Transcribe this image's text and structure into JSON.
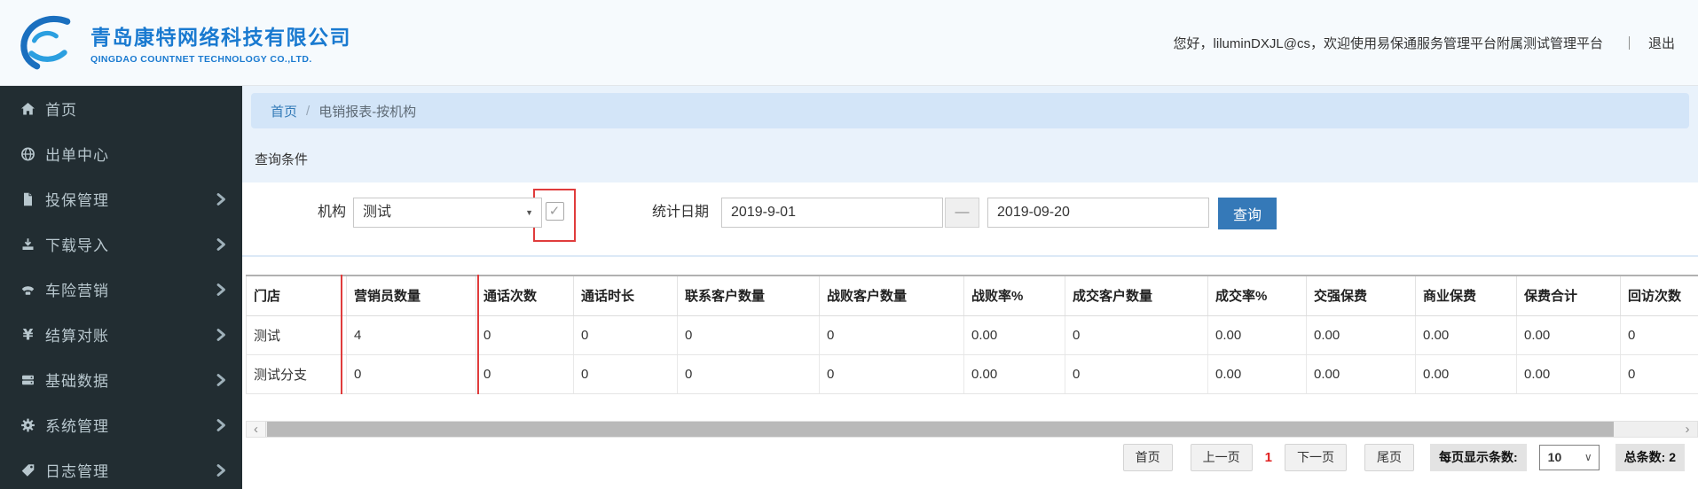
{
  "header": {
    "company_name_cn": "青岛康特网络科技有限公司",
    "company_name_en": "QINGDAO COUNTNET TECHNOLOGY CO.,LTD.",
    "greeting": "您好，liluminDXJL@cs，欢迎使用易保通服务管理平台附属测试管理平台",
    "divider": "｜",
    "logout_label": "退出"
  },
  "sidebar": {
    "items": [
      {
        "id": "home",
        "label": "首页",
        "icon": "home-icon",
        "has_submenu": false
      },
      {
        "id": "order-center",
        "label": "出单中心",
        "icon": "globe-icon",
        "has_submenu": false
      },
      {
        "id": "policy-mgmt",
        "label": "投保管理",
        "icon": "document-icon",
        "has_submenu": true
      },
      {
        "id": "download-import",
        "label": "下载导入",
        "icon": "download-icon",
        "has_submenu": true
      },
      {
        "id": "car-marketing",
        "label": "车险营销",
        "icon": "phone-icon",
        "has_submenu": true
      },
      {
        "id": "settlement",
        "label": "结算对账",
        "icon": "yen-icon",
        "has_submenu": true
      },
      {
        "id": "base-data",
        "label": "基础数据",
        "icon": "drive-icon",
        "has_submenu": true
      },
      {
        "id": "system-mgmt",
        "label": "系统管理",
        "icon": "gear-icon",
        "has_submenu": true
      },
      {
        "id": "log-mgmt",
        "label": "日志管理",
        "icon": "tag-icon",
        "has_submenu": true
      }
    ]
  },
  "breadcrumb": {
    "home": "首页",
    "separator": "/",
    "current": "电销报表-按机构"
  },
  "query": {
    "section_title": "查询条件",
    "org_label": "机构",
    "org_value": "测试",
    "checkbox_checked": true,
    "date_label": "统计日期",
    "date_from": "2019-9-01",
    "date_separator": "—",
    "date_to": "2019-09-20",
    "search_label": "查询"
  },
  "table": {
    "columns": [
      "门店",
      "营销员数量",
      "通话次数",
      "通话时长",
      "联系客户数量",
      "战败客户数量",
      "战败率%",
      "成交客户数量",
      "成交率%",
      "交强保费",
      "商业保费",
      "保费合计",
      "回访次数"
    ],
    "rows": [
      [
        "测试",
        "4",
        "0",
        "0",
        "0",
        "0",
        "0.00",
        "0",
        "0.00",
        "0.00",
        "0.00",
        "0.00",
        "0"
      ],
      [
        "测试分支",
        "0",
        "0",
        "0",
        "0",
        "0",
        "0.00",
        "0",
        "0.00",
        "0.00",
        "0.00",
        "0.00",
        "0"
      ]
    ]
  },
  "pagination": {
    "first": "首页",
    "prev": "上一页",
    "current_page": "1",
    "next": "下一页",
    "last": "尾页",
    "page_size_label": "每页显示条数:",
    "page_size": "10",
    "total_label": "总条数: 2"
  },
  "icons": {
    "caret_down": "▼",
    "caret_down_thin": "∨",
    "check": "✓",
    "scroll_left": "‹",
    "scroll_right": "›"
  },
  "colors": {
    "accent": "#337ab7",
    "annotation": "#e03c3c",
    "sidebar_bg": "#222d32",
    "content_bg": "#e9f2fb",
    "breadcrumb_bg": "#d3e5f8",
    "brand_blue": "#1a7ad0",
    "page_current": "#e02020"
  }
}
